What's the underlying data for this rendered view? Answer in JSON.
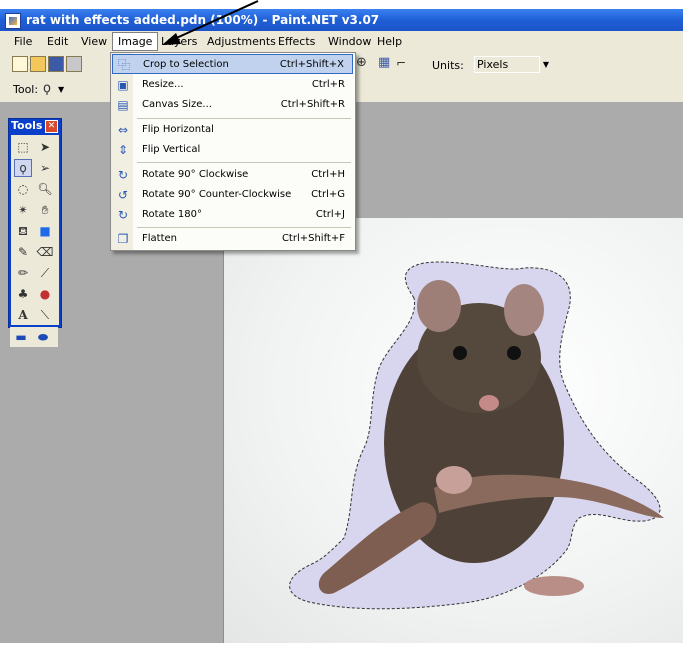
{
  "window": {
    "title": "rat with effects added.pdn (100%) - Paint.NET v3.07"
  },
  "menubar": {
    "items": [
      {
        "label": "File"
      },
      {
        "label": "Edit"
      },
      {
        "label": "View"
      },
      {
        "label": "Image"
      },
      {
        "label": "Layers"
      },
      {
        "label": "Adjustments"
      },
      {
        "label": "Effects"
      },
      {
        "label": "Window"
      },
      {
        "label": "Help"
      }
    ]
  },
  "toolbar": {
    "units_label": "Units:",
    "units_value": "Pixels"
  },
  "toolbar2": {
    "tool_label": "Tool:"
  },
  "tools_panel": {
    "title": "Tools",
    "close": "✕"
  },
  "image_menu": {
    "items": [
      {
        "label": "Crop to Selection",
        "shortcut": "Ctrl+Shift+X",
        "icon": "crop-icon",
        "glyph": "⿻"
      },
      {
        "label": "Resize...",
        "shortcut": "Ctrl+R",
        "icon": "resize-icon",
        "glyph": "▣"
      },
      {
        "label": "Canvas Size...",
        "shortcut": "Ctrl+Shift+R",
        "icon": "canvas-size-icon",
        "glyph": "▤"
      },
      {
        "label": "Flip Horizontal",
        "shortcut": "",
        "icon": "flip-horizontal-icon",
        "glyph": "⇔"
      },
      {
        "label": "Flip Vertical",
        "shortcut": "",
        "icon": "flip-vertical-icon",
        "glyph": "⇕"
      },
      {
        "label": "Rotate 90° Clockwise",
        "shortcut": "Ctrl+H",
        "icon": "rotate-cw-icon",
        "glyph": "↻"
      },
      {
        "label": "Rotate 90° Counter-Clockwise",
        "shortcut": "Ctrl+G",
        "icon": "rotate-ccw-icon",
        "glyph": "↺"
      },
      {
        "label": "Rotate 180°",
        "shortcut": "Ctrl+J",
        "icon": "rotate-180-icon",
        "glyph": "↻"
      },
      {
        "label": "Flatten",
        "shortcut": "Ctrl+Shift+F",
        "icon": "flatten-icon",
        "glyph": "❐"
      }
    ]
  }
}
